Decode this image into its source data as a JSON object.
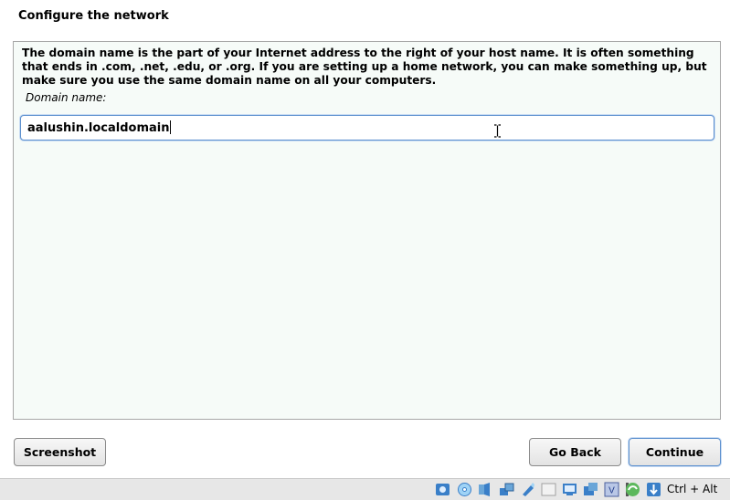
{
  "page": {
    "title": "Configure the network"
  },
  "panel": {
    "description": "The domain name is the part of your Internet address to the right of your host name.  It is often something that ends in .com, .net, .edu, or .org.  If you are setting up a home network, you can make something up, but make sure you use the same domain name on all your computers.",
    "field_label": "Domain name:",
    "field_value": "aalushin.localdomain"
  },
  "buttons": {
    "screenshot": "Screenshot",
    "go_back": "Go Back",
    "continue": "Continue"
  },
  "statusbar": {
    "host_key": "Ctrl + Alt",
    "icons": [
      "hard-disk-icon",
      "optical-drive-icon",
      "audio-icon",
      "network-icon",
      "usb-icon",
      "shared-folder-icon",
      "display-icon",
      "video-capture-icon",
      "cpu-icon",
      "virtualization-icon",
      "mouse-integration-icon",
      "keyboard-capture-icon"
    ]
  },
  "colors": {
    "panel_background": "#f6fbf8",
    "focus_border": "#5b8fce"
  }
}
